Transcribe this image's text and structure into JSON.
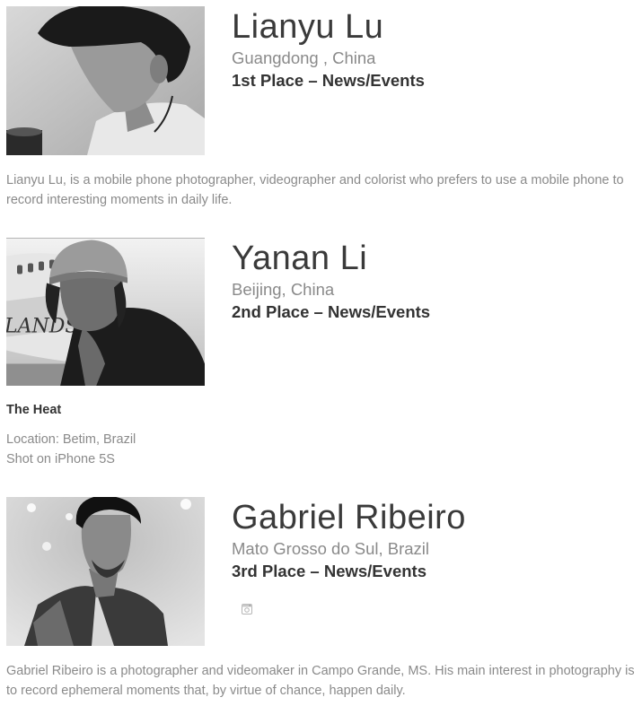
{
  "winners": [
    {
      "name": "Lianyu Lu",
      "location": "Guangdong , China",
      "place": "1st Place – News/Events",
      "photo_alt": "Lianyu Lu portrait",
      "bio": "Lianyu Lu, is a mobile phone photographer, videographer and colorist who prefers to use a mobile phone to record interesting moments in daily life."
    },
    {
      "name": "Yanan Li",
      "location": "Beijing, China",
      "place": "2nd Place – News/Events",
      "photo_alt": "Yanan Li portrait",
      "photo_title": "The Heat",
      "photo_location": "Location: Betim, Brazil",
      "photo_device": "Shot on iPhone 5S",
      "plane_text": "LANDS"
    },
    {
      "name": "Gabriel Ribeiro",
      "location": "Mato Grosso do Sul, Brazil",
      "place": "3rd Place – News/Events",
      "photo_alt": "Gabriel Ribeiro portrait",
      "social_icon": "instagram-icon",
      "bio": "Gabriel Ribeiro is a photographer and videomaker in Campo Grande, MS. His main interest in photography is to record ephemeral moments that, by virtue of chance, happen daily."
    }
  ],
  "colors": {
    "name_text": "#3a3a3a",
    "muted_text": "#8a8a8a",
    "strong_text": "#333333"
  }
}
